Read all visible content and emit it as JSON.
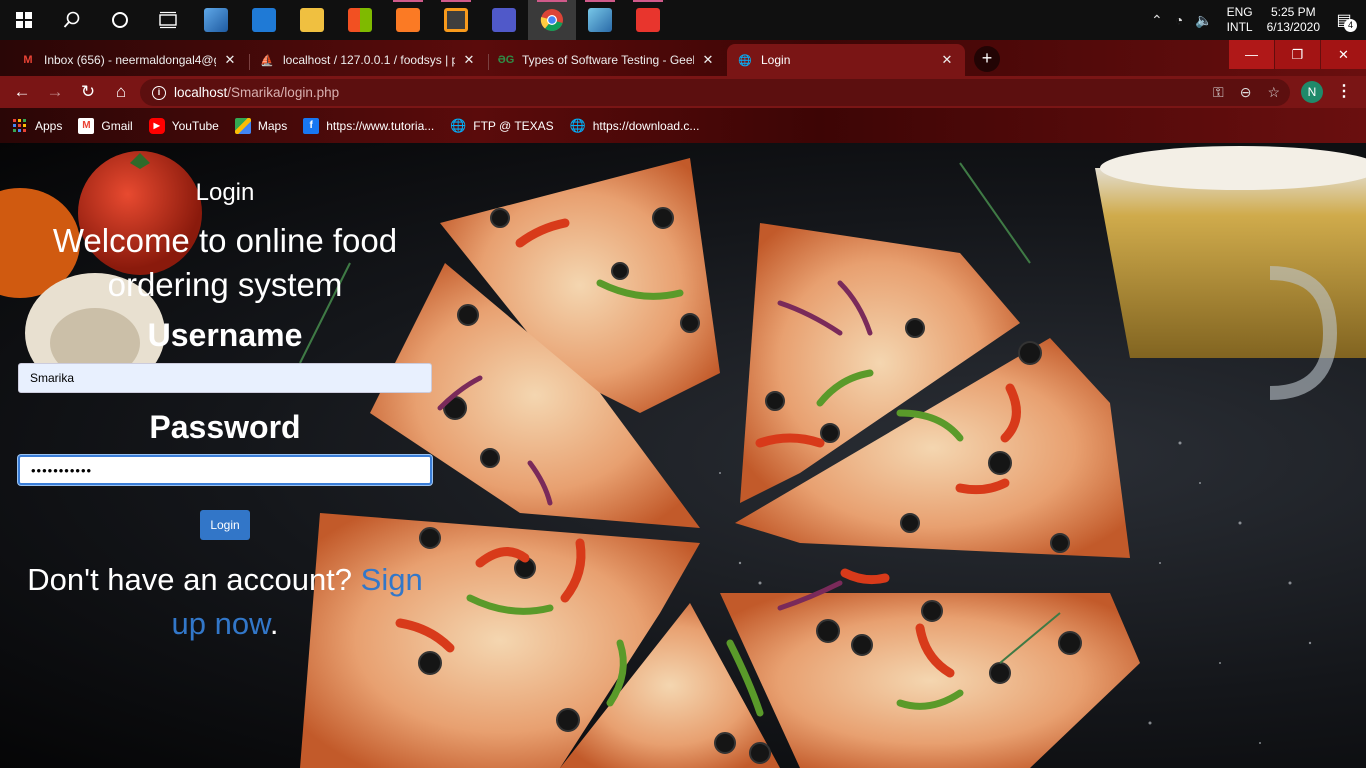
{
  "taskbar": {
    "language": [
      "ENG",
      "INTL"
    ],
    "time": "5:25 PM",
    "date": "6/13/2020",
    "notification_count": "4"
  },
  "tabs": [
    {
      "title": "Inbox (656) - neermaldongal4@g",
      "favicon": "gmail-icon"
    },
    {
      "title": "localhost / 127.0.0.1 / foodsys | p",
      "favicon": "phpmyadmin-icon"
    },
    {
      "title": "Types of Software Testing - Geek",
      "favicon": "geeksforgeeks-icon"
    },
    {
      "title": "Login",
      "favicon": "globe-icon"
    }
  ],
  "address_bar": {
    "host": "localhost",
    "path": "/Smarika/login.php"
  },
  "profile_initial": "N",
  "bookmarks": [
    {
      "label": "Apps",
      "icon": "apps-grid-icon"
    },
    {
      "label": "Gmail",
      "icon": "gmail-icon"
    },
    {
      "label": "YouTube",
      "icon": "youtube-icon"
    },
    {
      "label": "Maps",
      "icon": "maps-icon"
    },
    {
      "label": "https://www.tutoria...",
      "icon": "facebook-icon"
    },
    {
      "label": "FTP @ TEXAS",
      "icon": "globe-icon"
    },
    {
      "label": "https://download.c...",
      "icon": "globe-icon"
    }
  ],
  "login": {
    "heading": "Login",
    "welcome": "Welcome to online food ordering system",
    "username_label": "Username",
    "username_value": "Smarika",
    "password_label": "Password",
    "password_value": "•••••••••••",
    "button_label": "Login",
    "signup_prefix": "Don't have an account? ",
    "signup_link": "Sign up now",
    "signup_suffix": "."
  },
  "colors": {
    "chrome_theme": "#7a1515",
    "link": "#3277c9",
    "button": "#3276c8"
  }
}
